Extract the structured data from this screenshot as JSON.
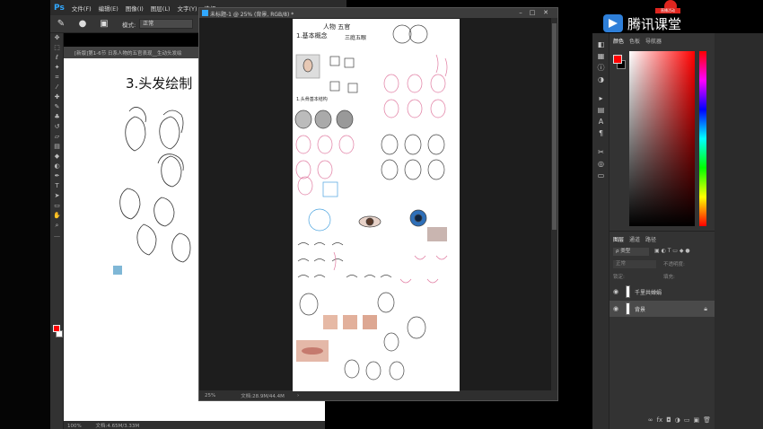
{
  "app": {
    "logo": "Ps",
    "menu": [
      "文件(F)",
      "编辑(E)",
      "图像(I)",
      "图层(L)",
      "文字(Y)",
      "选择"
    ],
    "options": {
      "mode_label": "模式:",
      "mode_value": "正常"
    }
  },
  "doc_background": {
    "tab_title": "[新版]第1-6节 日系人物的五官表现__生动头发绘",
    "tab_title_ext": "生动头发绘",
    "heading": "3.头发绘制",
    "status_zoom": "100%",
    "status_info": "文档:4.65M/3.33M"
  },
  "doc_main": {
    "title": "未标题-1 @ 25% (背景, RGB/8) *",
    "status_zoom": "25%",
    "status_info": "文档:28.9M/44.4M",
    "sketch_notes": [
      "人物 五官",
      "1.基本概念",
      "三庭五眼",
      "1.头骨基本结构"
    ]
  },
  "color_panel": {
    "tabs": [
      "颜色",
      "色板",
      "导航器"
    ],
    "foreground": "#ff0000",
    "background": "#000000"
  },
  "layers_panel": {
    "tabs": [
      "图层",
      "通道",
      "路径"
    ],
    "filter": "ρ 类型",
    "mode": "正常",
    "opacity_label": "不透明度:",
    "lock_label": "锁定:",
    "fill_label": "填充:",
    "layers": [
      {
        "name": "千里共婵娟"
      },
      {
        "name": "背景"
      }
    ]
  },
  "brand": {
    "text": "腾讯课堂",
    "ribbon": "直播活动"
  },
  "icons": {
    "toolbar": [
      "move-icon",
      "marquee-icon",
      "lasso-icon",
      "magic-wand-icon",
      "crop-icon",
      "eyedropper-icon",
      "healing-icon",
      "brush-icon",
      "stamp-icon",
      "history-brush-icon",
      "eraser-icon",
      "gradient-icon",
      "blur-icon",
      "dodge-icon",
      "pen-icon",
      "type-icon",
      "path-select-icon",
      "shape-icon",
      "hand-icon",
      "zoom-icon"
    ],
    "right_dock": [
      "color-icon",
      "swatches-icon",
      "info-icon",
      "adjustments-icon",
      "history-icon",
      "character-icon",
      "paragraph-icon",
      "tools-icon",
      "layers-icon",
      "channels-icon"
    ]
  }
}
